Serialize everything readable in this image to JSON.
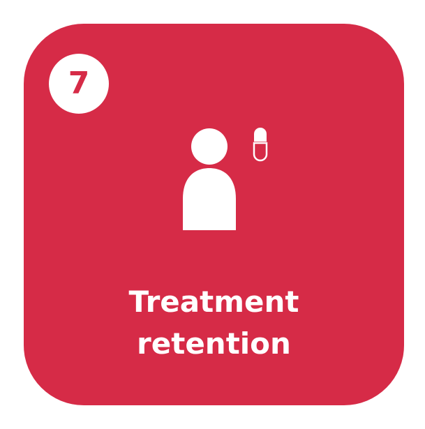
{
  "card": {
    "number": "7",
    "title_line1": "Treatment",
    "title_line2": "retention",
    "icon": "person-with-pill-icon",
    "colors": {
      "background": "#d62b47",
      "foreground": "#ffffff"
    }
  }
}
